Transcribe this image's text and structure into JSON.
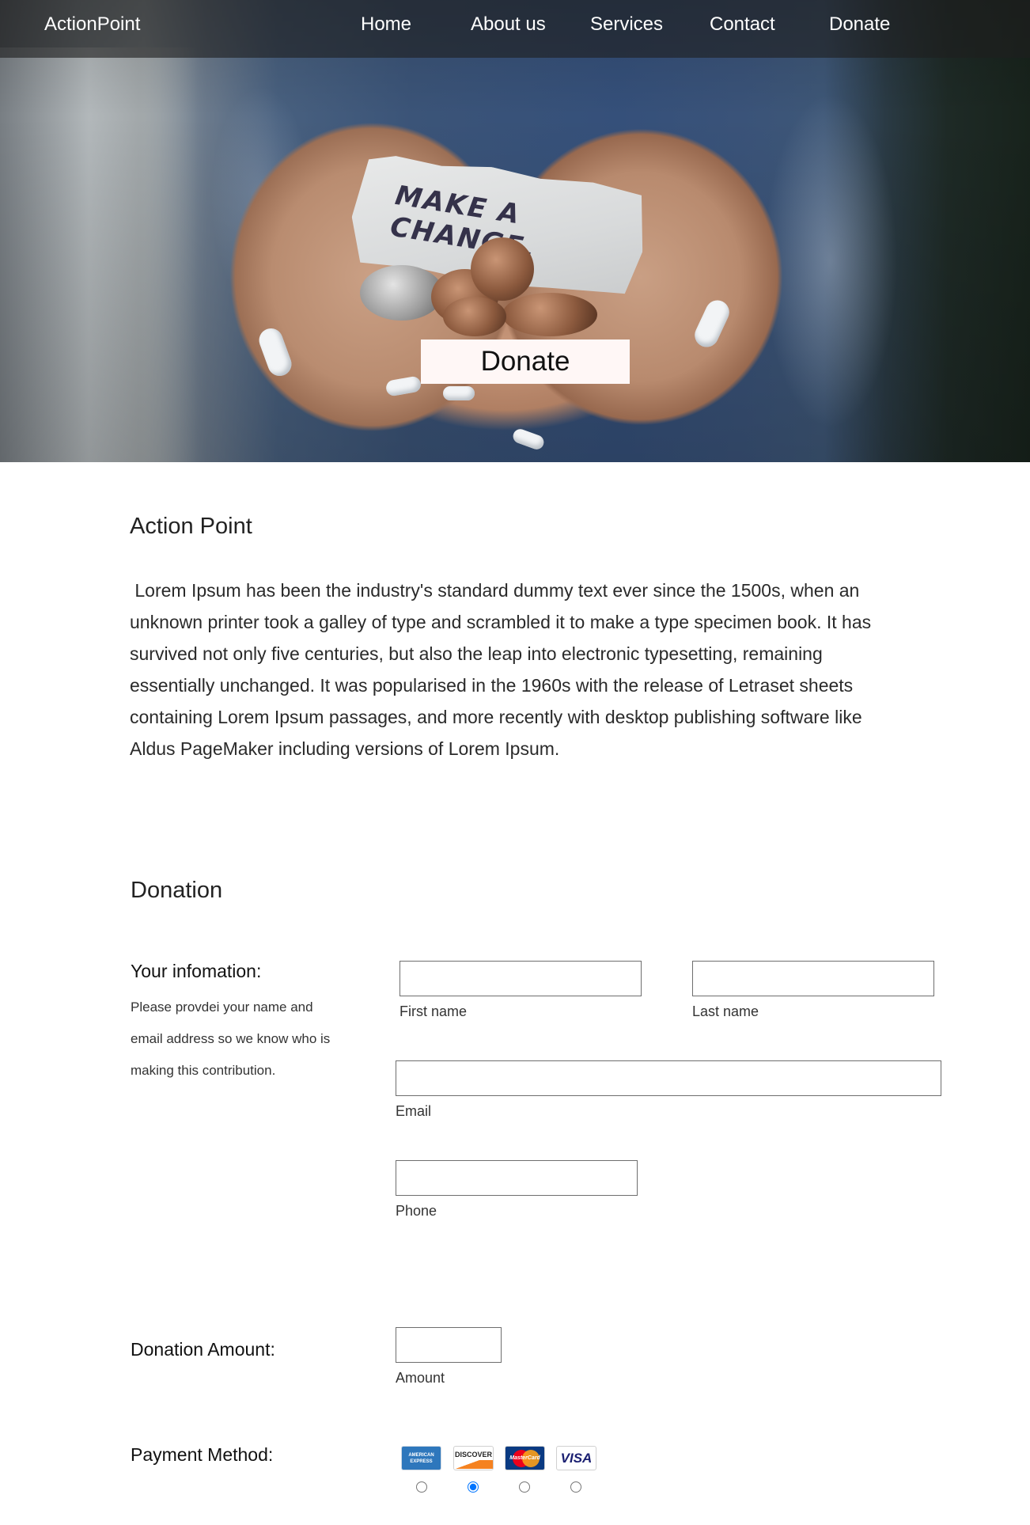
{
  "nav": {
    "brand": "ActionPoint",
    "links": [
      "Home",
      "About us",
      "Services",
      "Contact",
      "Donate"
    ]
  },
  "hero": {
    "paper_text": "MAKE A CHANGE.",
    "button_label": "Donate"
  },
  "about": {
    "title": "Action Point",
    "body": " Lorem Ipsum has been the industry's standard dummy text ever since the 1500s, when an unknown printer took a galley of type and scrambled it to make a type specimen book. It has survived not only five centuries, but also the leap into electronic typesetting, remaining essentially unchanged. It was popularised in the 1960s with the release of Letraset sheets containing Lorem Ipsum passages, and more recently with desktop publishing software like Aldus PageMaker including versions of Lorem Ipsum."
  },
  "donation": {
    "title": "Donation",
    "info_heading": "Your infomation:",
    "info_help": "Please provdei your name and email address so we know who is making this contribution.",
    "first_name_label": "First name",
    "last_name_label": "Last name",
    "email_label": "Email",
    "phone_label": "Phone",
    "amount_heading": "Donation Amount:",
    "amount_label": "Amount",
    "payment_heading": "Payment Method:",
    "cards": [
      {
        "name": "American Express",
        "icon": "amex-card-icon",
        "text": "AMERICAN EXPRESS",
        "color": "#2e77bc"
      },
      {
        "name": "Discover",
        "icon": "discover-card-icon",
        "text": "DISCOVER",
        "color": "#f58220"
      },
      {
        "name": "MasterCard",
        "icon": "mastercard-card-icon",
        "text": "MasterCard",
        "color": "#eb001b"
      },
      {
        "name": "Visa",
        "icon": "visa-card-icon",
        "text": "VISA",
        "color": "#1a1f71"
      }
    ],
    "selected_payment_index": 1
  },
  "colors": {
    "navbar_bg": "rgba(30,30,30,0.62)",
    "hero_button_bg": "#fff7f6",
    "radio_checked": "#1a73e8"
  }
}
